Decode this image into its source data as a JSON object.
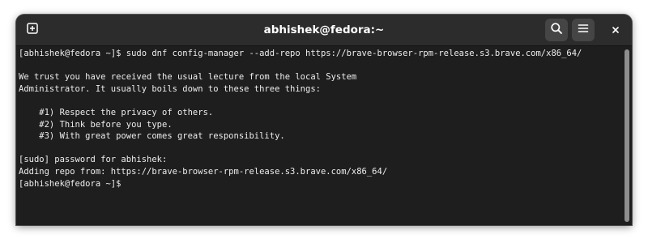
{
  "window": {
    "title": "abhishek@fedora:~"
  },
  "titlebar": {
    "new_tab_icon": "plus-box-icon",
    "search_icon": "search-icon",
    "menu_icon": "hamburger-menu-icon",
    "close_icon": "close-icon"
  },
  "terminal": {
    "lines": [
      "[abhishek@fedora ~]$ sudo dnf config-manager --add-repo https://brave-browser-rpm-release.s3.brave.com/x86_64/",
      "",
      "We trust you have received the usual lecture from the local System",
      "Administrator. It usually boils down to these three things:",
      "",
      "    #1) Respect the privacy of others.",
      "    #2) Think before you type.",
      "    #3) With great power comes great responsibility.",
      "",
      "[sudo] password for abhishek:",
      "Adding repo from: https://brave-browser-rpm-release.s3.brave.com/x86_64/",
      "[abhishek@fedora ~]$ "
    ]
  },
  "colors": {
    "titlebar_bg": "#2c2c2c",
    "terminal_bg": "#1e1e1e",
    "terminal_fg": "#ededed",
    "button_bg": "#454545",
    "scrollbar_thumb": "#8e8e8e"
  }
}
